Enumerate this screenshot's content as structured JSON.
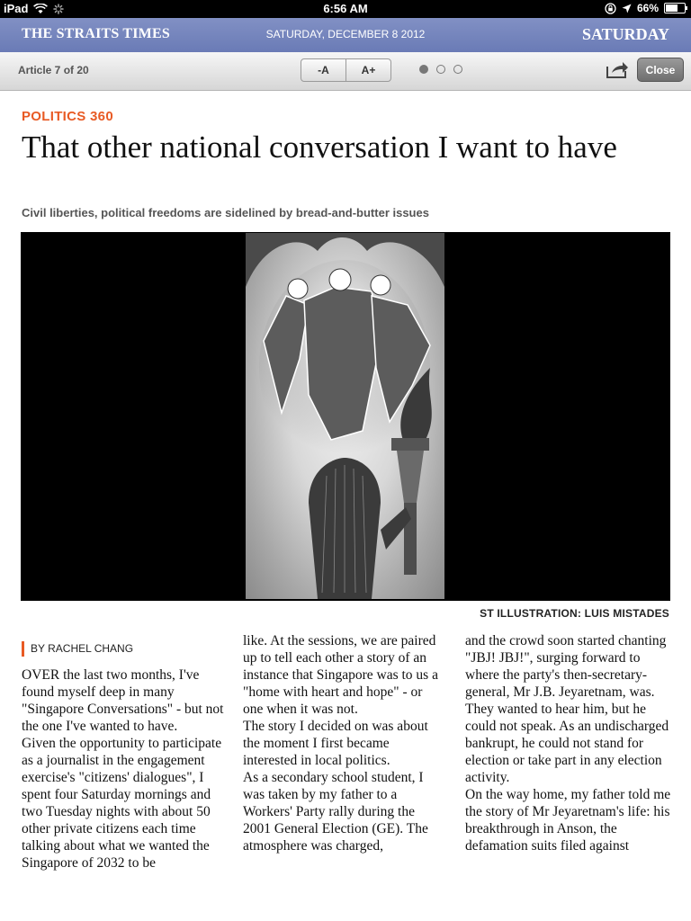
{
  "status_bar": {
    "device": "iPad",
    "time": "6:56 AM",
    "battery": "66%",
    "battery_fraction": 0.66
  },
  "masthead": {
    "brand": "THE STRAITS TIMES",
    "date": "SATURDAY, DECEMBER 8 2012",
    "edition": "SATURDAY"
  },
  "toolbar": {
    "article_count": "Article 7 of 20",
    "font_decrease": "-A",
    "font_increase": "A+",
    "close_label": "Close",
    "page_dots": 3,
    "active_dot": 0
  },
  "article": {
    "section": "POLITICS 360",
    "headline": "That other national conversation I want to have",
    "subhead": "Civil liberties, political freedoms are sidelined by bread-and-butter issues",
    "image_credit": "ST ILLUSTRATION: LUIS MISTADES",
    "byline": "BY RACHEL CHANG",
    "columns": [
      {
        "paragraphs": [
          "OVER the last two months, I've found myself deep in many \"Singapore Conversations\" - but not the one I've wanted to have.",
          " Given the opportunity to participate as a journalist in the engagement exercise's \"citizens' dialogues\", I spent four Saturday mornings and two Tuesday nights with about 50 other private citizens each time talking about what we wanted the Singapore of 2032 to be"
        ]
      },
      {
        "paragraphs": [
          "like. At the sessions, we are paired up to tell each other a story of an instance that Singapore was to us a \"home with heart and hope\" - or one when it was not.",
          " The story I decided on was about the moment I first became interested in local politics.",
          " As a secondary school student, I was taken by my father to a Workers' Party rally during the 2001 General Election (GE). The atmosphere was charged,"
        ]
      },
      {
        "paragraphs": [
          "and the crowd soon started chanting \"JBJ! JBJ!\", surging forward to where the party's then-secretary-general, Mr J.B. Jeyaretnam, was. They wanted to hear him, but he could not speak. As an undischarged bankrupt, he could not stand for election or take part in any election activity.",
          " On the way home, my father told me the story of Mr Jeyaretnam's life: his breakthrough in Anson, the defamation suits filed against"
        ]
      }
    ]
  },
  "colors": {
    "masthead": "#7486bd",
    "accent": "#e85a24",
    "figure_bg": "#000000"
  }
}
